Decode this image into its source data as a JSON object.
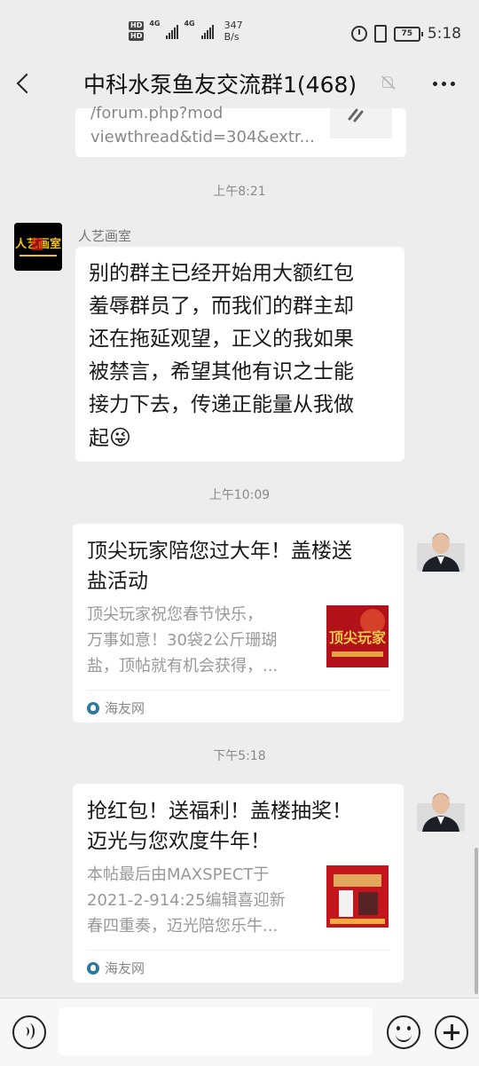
{
  "statusbar": {
    "hd1": "HD",
    "hd2": "HD",
    "net1": "4G",
    "net2": "4G",
    "speed_value": "347",
    "speed_unit": "B/s",
    "battery": "75",
    "time": "5:18"
  },
  "navbar": {
    "title": "中科水泵鱼友交流群1(468)"
  },
  "messages": {
    "link_preview": {
      "line1": "/forum.php?mod",
      "line2": "viewthread&tid=304&extr..."
    },
    "time1": "上午8:21",
    "msg1": {
      "sender": "人艺画室",
      "avatar_text": "人艺画室",
      "lines": [
        "别的群主已经开始用大额红包",
        "羞辱群员了，而我们的群主却",
        "还在拖延观望，正义的我如果",
        "被禁言，希望其他有识之士能",
        "接力下去，传递正能量从我做",
        "起"
      ],
      "emoji": "😜"
    },
    "time2": "上午10:09",
    "card1": {
      "title_lines": [
        "顶尖玩家陪您过大年！盖楼送",
        "盐活动"
      ],
      "desc_lines": [
        "顶尖玩家祝您春节快乐，",
        "万事如意！30袋2公斤珊瑚",
        "盐，顶帖就有机会获得，..."
      ],
      "thumb_text": "顶尖玩家",
      "source": "海友网"
    },
    "time3": "下午5:18",
    "card2": {
      "title_lines": [
        "抢红包！送福利！盖楼抽奖！",
        "迈光与您欢度牛年！"
      ],
      "desc_lines": [
        "本帖最后由MAXSPECT于",
        "2021-2-914:25编辑喜迎新",
        "春四重奏，迈光陪您乐牛..."
      ],
      "source": "海友网"
    }
  },
  "colors": {
    "background": "#ededed",
    "bubble": "#ffffff",
    "time_text": "#8a8a8a"
  }
}
